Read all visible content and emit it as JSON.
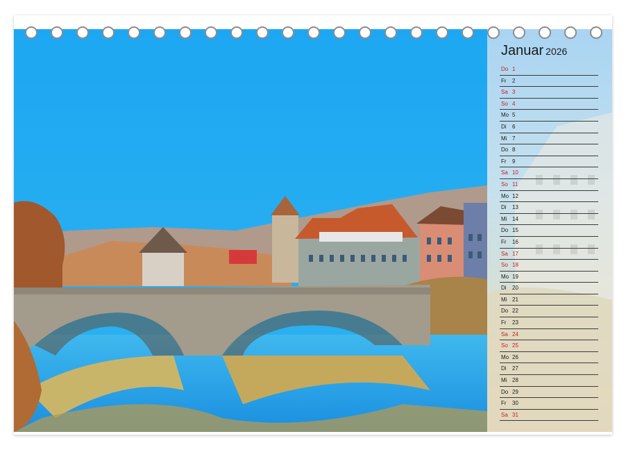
{
  "calendar": {
    "month": "Januar",
    "year": "2026",
    "weekend_color": "#c4202a",
    "days": [
      {
        "wd": "Do",
        "d": "1",
        "we": true
      },
      {
        "wd": "Fr",
        "d": "2",
        "we": false
      },
      {
        "wd": "Sa",
        "d": "3",
        "we": true
      },
      {
        "wd": "So",
        "d": "4",
        "we": true
      },
      {
        "wd": "Mo",
        "d": "5",
        "we": false
      },
      {
        "wd": "Di",
        "d": "6",
        "we": false
      },
      {
        "wd": "Mi",
        "d": "7",
        "we": false
      },
      {
        "wd": "Do",
        "d": "8",
        "we": false
      },
      {
        "wd": "Fr",
        "d": "9",
        "we": false
      },
      {
        "wd": "Sa",
        "d": "10",
        "we": true
      },
      {
        "wd": "So",
        "d": "11",
        "we": true
      },
      {
        "wd": "Mo",
        "d": "12",
        "we": false
      },
      {
        "wd": "Di",
        "d": "13",
        "we": false
      },
      {
        "wd": "Mi",
        "d": "14",
        "we": false
      },
      {
        "wd": "Do",
        "d": "15",
        "we": false
      },
      {
        "wd": "Fr",
        "d": "16",
        "we": false
      },
      {
        "wd": "Sa",
        "d": "17",
        "we": true
      },
      {
        "wd": "So",
        "d": "18",
        "we": true
      },
      {
        "wd": "Mo",
        "d": "19",
        "we": false
      },
      {
        "wd": "Di",
        "d": "20",
        "we": false
      },
      {
        "wd": "Mi",
        "d": "21",
        "we": false
      },
      {
        "wd": "Do",
        "d": "22",
        "we": false
      },
      {
        "wd": "Fr",
        "d": "23",
        "we": false
      },
      {
        "wd": "Sa",
        "d": "24",
        "we": true
      },
      {
        "wd": "So",
        "d": "25",
        "we": true
      },
      {
        "wd": "Mo",
        "d": "26",
        "we": false
      },
      {
        "wd": "Di",
        "d": "27",
        "we": false
      },
      {
        "wd": "Mi",
        "d": "28",
        "we": false
      },
      {
        "wd": "Do",
        "d": "29",
        "we": false
      },
      {
        "wd": "Fr",
        "d": "30",
        "we": false
      },
      {
        "wd": "Sa",
        "d": "31",
        "we": true
      }
    ]
  },
  "photo": {
    "subject": "stone-arch-bridge-over-river-with-old-town"
  }
}
